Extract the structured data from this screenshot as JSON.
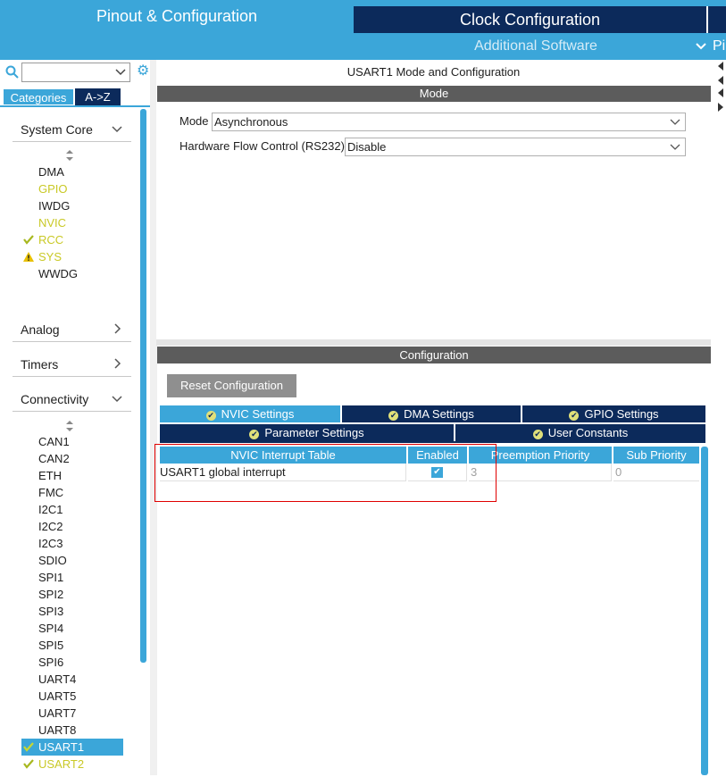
{
  "header": {
    "tab_pinout": "Pinout & Configuration",
    "tab_clock": "Clock Configuration",
    "additional_software": "Additional Software",
    "cut_off_tab": "Pi",
    "colors": {
      "accent": "#3ba6d9",
      "dark": "#0c2a5b"
    }
  },
  "left": {
    "search_placeholder": "",
    "tab_categories": "Categories",
    "tab_az": "A->Z",
    "system_core": {
      "label": "System Core",
      "items": [
        "DMA",
        "GPIO",
        "IWDG",
        "NVIC",
        "RCC",
        "SYS",
        "WWDG"
      ]
    },
    "analog": "Analog",
    "timers": "Timers",
    "connectivity": {
      "label": "Connectivity",
      "items": [
        "CAN1",
        "CAN2",
        "ETH",
        "FMC",
        "I2C1",
        "I2C2",
        "I2C3",
        "SDIO",
        "SPI1",
        "SPI2",
        "SPI3",
        "SPI4",
        "SPI5",
        "SPI6",
        "UART4",
        "UART5",
        "UART7",
        "UART8",
        "USART1",
        "USART2"
      ]
    }
  },
  "mode_panel": {
    "title": "USART1 Mode and Configuration",
    "section": "Mode",
    "mode_label": "Mode",
    "mode_value": "Asynchronous",
    "hfc_label": "Hardware Flow Control (RS232)",
    "hfc_value": "Disable"
  },
  "config_panel": {
    "section": "Configuration",
    "reset_button": "Reset Configuration",
    "tabs": [
      "NVIC Settings",
      "DMA Settings",
      "GPIO Settings",
      "Parameter Settings",
      "User Constants"
    ],
    "table": {
      "headers": [
        "NVIC Interrupt Table",
        "Enabled",
        "Preemption Priority",
        "Sub Priority"
      ],
      "row": {
        "name": "USART1 global interrupt",
        "enabled": true,
        "preemption": "3",
        "sub": "0"
      }
    }
  }
}
